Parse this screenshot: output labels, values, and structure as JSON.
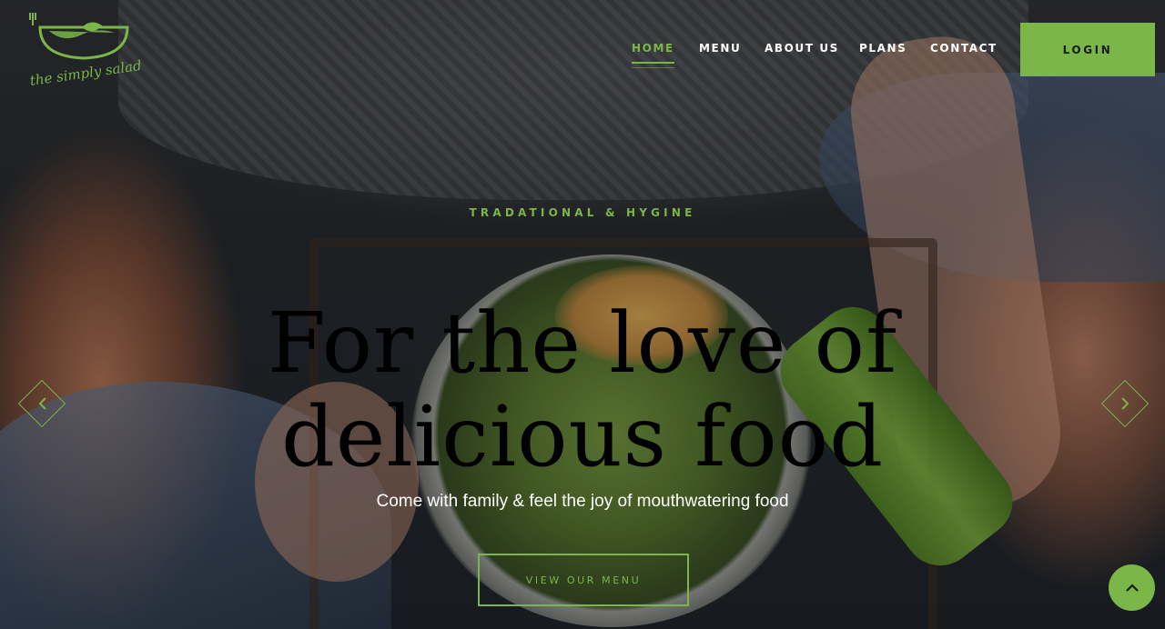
{
  "brand": {
    "name": "the simply salad",
    "accent": "#7ab648"
  },
  "nav": {
    "items": [
      {
        "label": "HOME",
        "active": true
      },
      {
        "label": "MENU",
        "active": false
      },
      {
        "label": "ABOUT US",
        "active": false
      },
      {
        "label": "PLANS",
        "active": false
      },
      {
        "label": "CONTACT",
        "active": false
      }
    ],
    "login_label": "LOGIN"
  },
  "hero": {
    "eyebrow": "TRADATIONAL & HYGINE",
    "headline_line1": "For the love of",
    "headline_line2": "delicious food",
    "subline": "Come with family & feel the joy of mouthwatering food",
    "cta_label": "VIEW OUR MENU"
  },
  "controls": {
    "prev_icon": "chevron-left-icon",
    "next_icon": "chevron-right-icon",
    "scroll_top_icon": "chevron-up-icon"
  }
}
